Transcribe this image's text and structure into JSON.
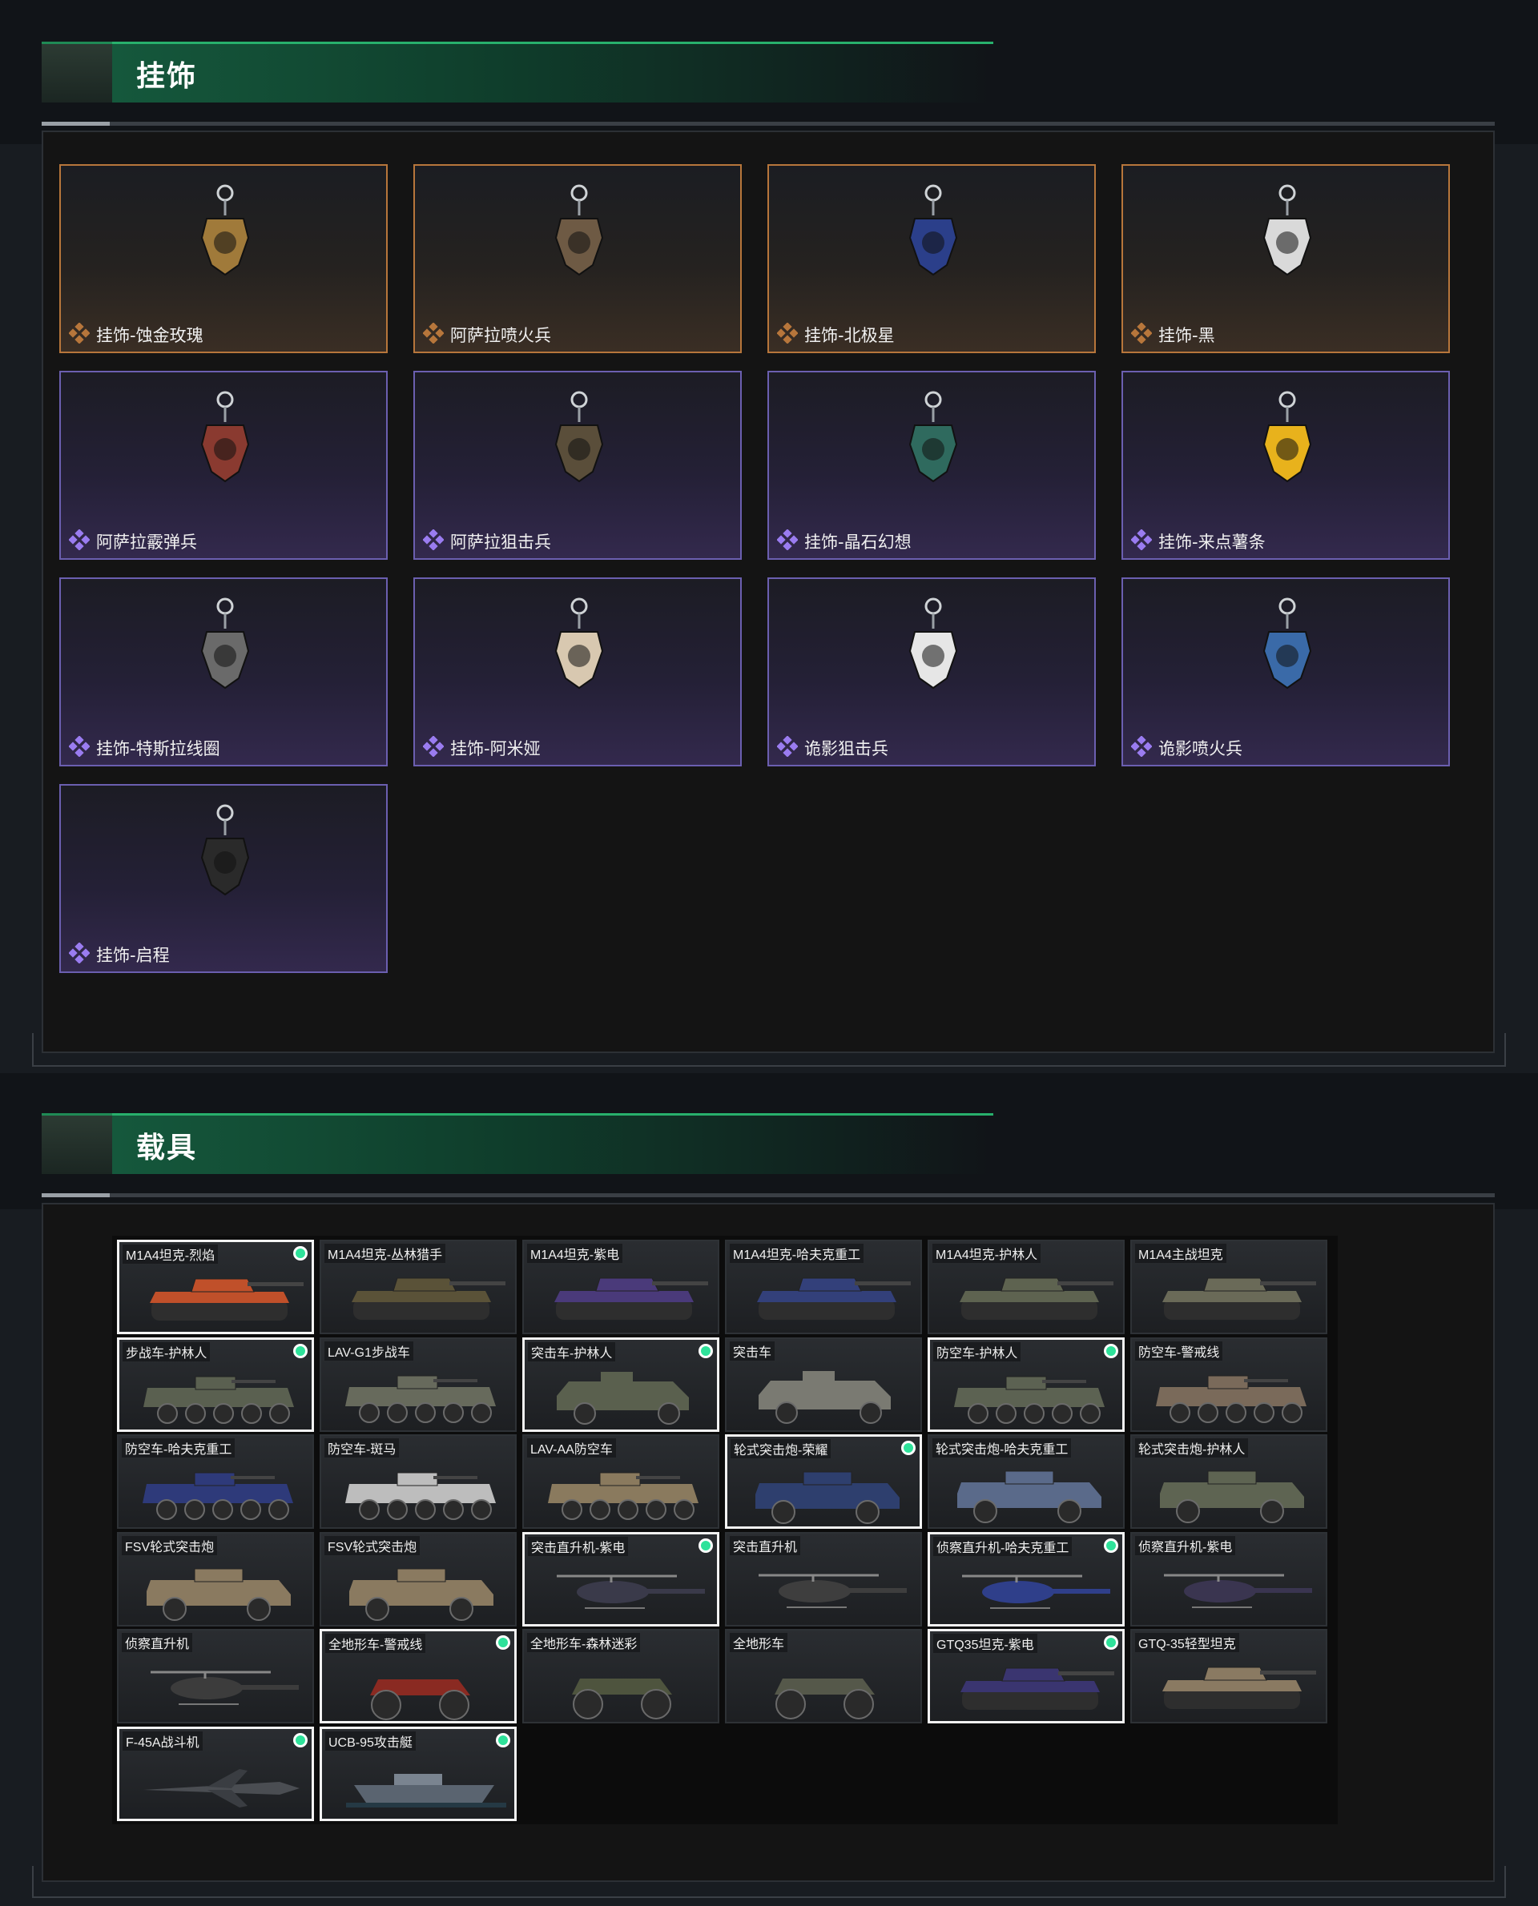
{
  "colors": {
    "accent_green": "#28b06c",
    "gold_rarity": "#b7763b",
    "purple_rarity": "#6b5fb0",
    "owned_dot": "#2ee29a"
  },
  "charms_section": {
    "title": "挂饰",
    "items": [
      {
        "label": "挂饰-蚀金玫瑰",
        "rarity": "gold",
        "icon": "rose-medallion-charm"
      },
      {
        "label": "阿萨拉喷火兵",
        "rarity": "gold",
        "icon": "flamethrower-soldier-charm"
      },
      {
        "label": "挂饰-北极星",
        "rarity": "gold",
        "icon": "north-star-charm"
      },
      {
        "label": "挂饰-黑",
        "rarity": "gold",
        "icon": "black-tag-charm"
      },
      {
        "label": "阿萨拉霰弹兵",
        "rarity": "purple",
        "icon": "shotgun-soldier-charm"
      },
      {
        "label": "阿萨拉狙击兵",
        "rarity": "purple",
        "icon": "sniper-soldier-charm"
      },
      {
        "label": "挂饰-晶石幻想",
        "rarity": "purple",
        "icon": "crystal-cube-charm"
      },
      {
        "label": "挂饰-来点薯条",
        "rarity": "purple",
        "icon": "fries-charm"
      },
      {
        "label": "挂饰-特斯拉线圈",
        "rarity": "purple",
        "icon": "tesla-coil-charm"
      },
      {
        "label": "挂饰-阿米娅",
        "rarity": "purple",
        "icon": "bunny-charm"
      },
      {
        "label": "诡影狙击兵",
        "rarity": "purple",
        "icon": "ghost-sniper-charm"
      },
      {
        "label": "诡影喷火兵",
        "rarity": "purple",
        "icon": "ghost-flamer-charm"
      },
      {
        "label": "挂饰-启程",
        "rarity": "purple",
        "icon": "launch-emblem-charm"
      }
    ]
  },
  "vehicles_section": {
    "title": "载具",
    "items": [
      {
        "label": "M1A4坦克-烈焰",
        "owned": true,
        "kind": "tank",
        "tint": "#c0502a"
      },
      {
        "label": "M1A4坦克-丛林猎手",
        "owned": false,
        "kind": "tank",
        "tint": "#5a5238"
      },
      {
        "label": "M1A4坦克-紫电",
        "owned": false,
        "kind": "tank",
        "tint": "#4a3a7a"
      },
      {
        "label": "M1A4坦克-哈夫克重工",
        "owned": false,
        "kind": "tank",
        "tint": "#33407a"
      },
      {
        "label": "M1A4坦克-护林人",
        "owned": false,
        "kind": "tank",
        "tint": "#5e6350"
      },
      {
        "label": "M1A4主战坦克",
        "owned": false,
        "kind": "tank",
        "tint": "#6a6a58"
      },
      {
        "label": "步战车-护林人",
        "owned": true,
        "kind": "ifv",
        "tint": "#5a6050"
      },
      {
        "label": "LAV-G1步战车",
        "owned": false,
        "kind": "ifv",
        "tint": "#676a5c"
      },
      {
        "label": "突击车-护林人",
        "owned": true,
        "kind": "jeep",
        "tint": "#5a604e"
      },
      {
        "label": "突击车",
        "owned": false,
        "kind": "jeep",
        "tint": "#7a7a72"
      },
      {
        "label": "防空车-护林人",
        "owned": true,
        "kind": "ifv",
        "tint": "#5c6252"
      },
      {
        "label": "防空车-警戒线",
        "owned": false,
        "kind": "ifv",
        "tint": "#7a6a5a"
      },
      {
        "label": "防空车-哈夫克重工",
        "owned": false,
        "kind": "ifv",
        "tint": "#2e3a7a"
      },
      {
        "label": "防空车-斑马",
        "owned": false,
        "kind": "ifv",
        "tint": "#bdbdbd"
      },
      {
        "label": "LAV-AA防空车",
        "owned": false,
        "kind": "ifv",
        "tint": "#8a7a5e"
      },
      {
        "label": "轮式突击炮-荣耀",
        "owned": true,
        "kind": "armored",
        "tint": "#2e3f6e"
      },
      {
        "label": "轮式突击炮-哈夫克重工",
        "owned": false,
        "kind": "armored",
        "tint": "#5a6a8a"
      },
      {
        "label": "轮式突击炮-护林人",
        "owned": false,
        "kind": "armored",
        "tint": "#5e6452"
      },
      {
        "label": "FSV轮式突击炮",
        "owned": false,
        "kind": "armored",
        "tint": "#8a7a60"
      },
      {
        "label": "FSV轮式突击炮",
        "owned": false,
        "kind": "armored",
        "tint": "#8a7a60"
      },
      {
        "label": "突击直升机-紫电",
        "owned": true,
        "kind": "heli",
        "tint": "#3a3a4a"
      },
      {
        "label": "突击直升机",
        "owned": false,
        "kind": "heli",
        "tint": "#3e3e3e"
      },
      {
        "label": "侦察直升机-哈夫克重工",
        "owned": true,
        "kind": "heli",
        "tint": "#2f3f8a"
      },
      {
        "label": "侦察直升机-紫电",
        "owned": false,
        "kind": "heli",
        "tint": "#3a3550"
      },
      {
        "label": "侦察直升机",
        "owned": false,
        "kind": "heli",
        "tint": "#3c3c3c"
      },
      {
        "label": "全地形车-警戒线",
        "owned": true,
        "kind": "atv",
        "tint": "#8a2a22"
      },
      {
        "label": "全地形车-森林迷彩",
        "owned": false,
        "kind": "atv",
        "tint": "#4e543e"
      },
      {
        "label": "全地形车",
        "owned": false,
        "kind": "atv",
        "tint": "#55584a"
      },
      {
        "label": "GTQ35坦克-紫电",
        "owned": true,
        "kind": "tank",
        "tint": "#3a3570"
      },
      {
        "label": "GTQ-35轻型坦克",
        "owned": false,
        "kind": "tank",
        "tint": "#8a7a62"
      },
      {
        "label": "F-45A战斗机",
        "owned": true,
        "kind": "jet",
        "tint": "#4a4d52"
      },
      {
        "label": "UCB-95攻击艇",
        "owned": true,
        "kind": "boat",
        "tint": "#5a6470"
      }
    ]
  }
}
